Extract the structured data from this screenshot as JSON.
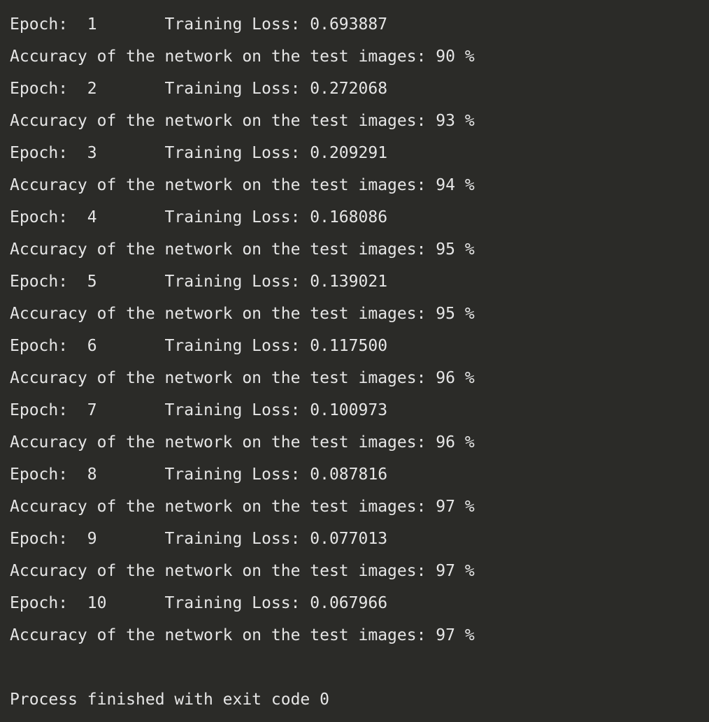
{
  "console": {
    "background_color": "#2b2b28",
    "text_color": "#e6e6e6",
    "epoch_label": "Epoch:",
    "loss_label": "Training Loss:",
    "accuracy_prefix": "Accuracy of the network on the test images:",
    "accuracy_suffix": "%",
    "exit_message": "Process finished with exit code 0",
    "lines": [
      "Epoch:  1 \tTraining Loss: 0.693887",
      "Accuracy of the network on the test images: 90 %",
      "Epoch:  2 \tTraining Loss: 0.272068",
      "Accuracy of the network on the test images: 93 %",
      "Epoch:  3 \tTraining Loss: 0.209291",
      "Accuracy of the network on the test images: 94 %",
      "Epoch:  4 \tTraining Loss: 0.168086",
      "Accuracy of the network on the test images: 95 %",
      "Epoch:  5 \tTraining Loss: 0.139021",
      "Accuracy of the network on the test images: 95 %",
      "Epoch:  6 \tTraining Loss: 0.117500",
      "Accuracy of the network on the test images: 96 %",
      "Epoch:  7 \tTraining Loss: 0.100973",
      "Accuracy of the network on the test images: 96 %",
      "Epoch:  8 \tTraining Loss: 0.087816",
      "Accuracy of the network on the test images: 97 %",
      "Epoch:  9 \tTraining Loss: 0.077013",
      "Accuracy of the network on the test images: 97 %",
      "Epoch:  10 \tTraining Loss: 0.067966",
      "Accuracy of the network on the test images: 97 %",
      "",
      "Process finished with exit code 0"
    ],
    "epochs": [
      {
        "epoch": "1",
        "training_loss": "0.693887",
        "accuracy": "90"
      },
      {
        "epoch": "2",
        "training_loss": "0.272068",
        "accuracy": "93"
      },
      {
        "epoch": "3",
        "training_loss": "0.209291",
        "accuracy": "94"
      },
      {
        "epoch": "4",
        "training_loss": "0.168086",
        "accuracy": "95"
      },
      {
        "epoch": "5",
        "training_loss": "0.139021",
        "accuracy": "95"
      },
      {
        "epoch": "6",
        "training_loss": "0.117500",
        "accuracy": "96"
      },
      {
        "epoch": "7",
        "training_loss": "0.100973",
        "accuracy": "96"
      },
      {
        "epoch": "8",
        "training_loss": "0.087816",
        "accuracy": "97"
      },
      {
        "epoch": "9",
        "training_loss": "0.077013",
        "accuracy": "97"
      },
      {
        "epoch": "10",
        "training_loss": "0.067966",
        "accuracy": "97"
      }
    ],
    "exit_code": "0"
  }
}
